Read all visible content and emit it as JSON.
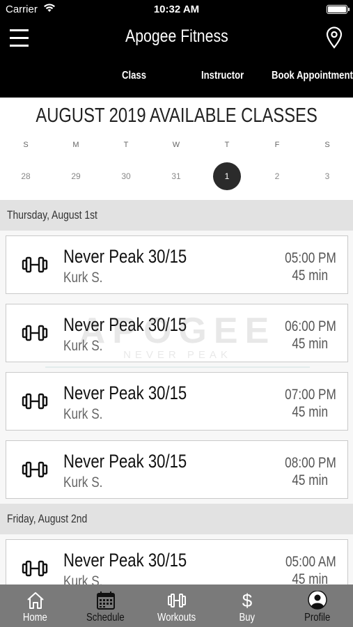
{
  "status_bar": {
    "carrier": "Carrier",
    "time": "10:32 AM"
  },
  "header": {
    "title": "Apogee Fitness",
    "menu_icon": "hamburger-icon",
    "location_icon": "map-pin-icon",
    "nav": [
      "Class",
      "Instructor",
      "Book Appointment"
    ]
  },
  "calendar": {
    "title": "AUGUST 2019 AVAILABLE CLASSES",
    "weekdays": [
      "S",
      "M",
      "T",
      "W",
      "T",
      "F",
      "S"
    ],
    "days": [
      "28",
      "29",
      "30",
      "31",
      "1",
      "2",
      "3"
    ],
    "selected_day": "1"
  },
  "watermark": {
    "brand": "APOGEE",
    "tagline": "NEVER PEAK"
  },
  "schedule": [
    {
      "date": "Thursday, August 1st",
      "classes": [
        {
          "name": "Never Peak  30/15",
          "instructor": "Kurk S.",
          "time": "05:00 PM",
          "duration": "45 min"
        },
        {
          "name": "Never Peak  30/15",
          "instructor": "Kurk S.",
          "time": "06:00 PM",
          "duration": "45 min"
        },
        {
          "name": "Never Peak  30/15",
          "instructor": "Kurk S.",
          "time": "07:00 PM",
          "duration": "45 min"
        },
        {
          "name": "Never Peak  30/15",
          "instructor": "Kurk S.",
          "time": "08:00 PM",
          "duration": "45 min"
        }
      ]
    },
    {
      "date": "Friday, August 2nd",
      "classes": [
        {
          "name": "Never Peak  30/15",
          "instructor": "Kurk S.",
          "time": "05:00 AM",
          "duration": "45 min"
        }
      ]
    }
  ],
  "tabbar": {
    "active": "Profile",
    "tabs": [
      {
        "label": "Home",
        "icon": "home-icon"
      },
      {
        "label": "Schedule",
        "icon": "calendar-icon"
      },
      {
        "label": "Workouts",
        "icon": "dumbbell-icon"
      },
      {
        "label": "Buy",
        "icon": "dollar-icon"
      },
      {
        "label": "Profile",
        "icon": "profile-icon"
      }
    ]
  },
  "colors": {
    "header_bg": "#000000",
    "tabbar_bg": "#7a7a7a",
    "selected_day_bg": "#2b2b2b",
    "date_header_bg": "#e2e2e2"
  }
}
